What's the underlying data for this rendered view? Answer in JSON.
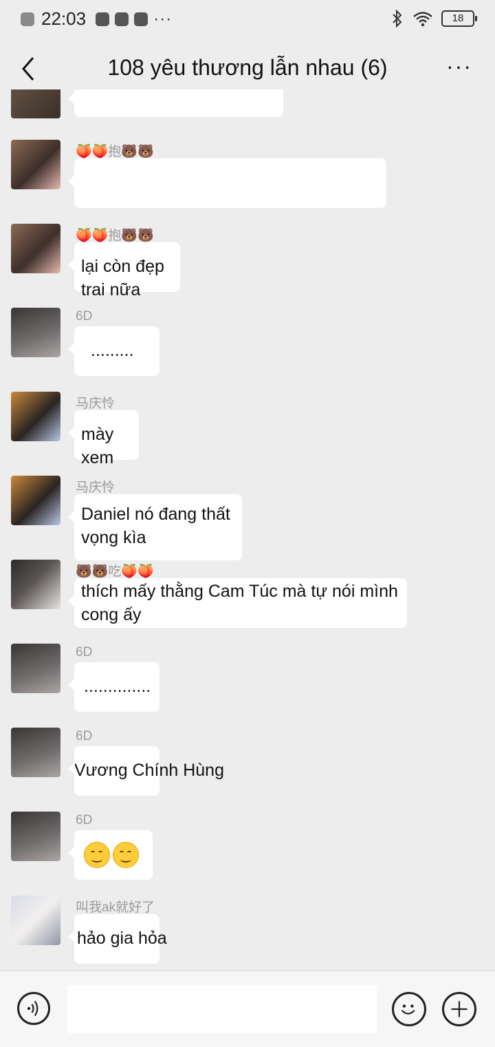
{
  "status_bar": {
    "time": "22:03",
    "battery": "18"
  },
  "header": {
    "title": "108 yêu thương lẫn nhau (6)"
  },
  "messages": [
    {
      "sender": "",
      "text": ""
    },
    {
      "sender": "🍑🍑抱🐻🐻",
      "text": ""
    },
    {
      "sender": "🍑🍑抱🐻🐻",
      "text": "lại còn đẹp trai nữa"
    },
    {
      "sender": "6D",
      "text": "........."
    },
    {
      "sender": "马庆怜",
      "text": "mày xem"
    },
    {
      "sender": "马庆怜",
      "text": "Daniel nó đang thất vọng kìa"
    },
    {
      "sender": "🐻🐻吃🍑🍑",
      "text": "thích mấy thằng Cam Túc mà tự nói mình cong ấy"
    },
    {
      "sender": "6D",
      "text": ".............."
    },
    {
      "sender": "6D",
      "text": "Vương Chính Hùng"
    },
    {
      "sender": "6D",
      "emoji": "smiling-face-emoji x2"
    },
    {
      "sender": "叫我ak就好了",
      "text": "hảo gia hỏa"
    }
  ],
  "colors": {
    "background": "#ededed",
    "bubble": "#ffffff",
    "sender": "#9a9a9a",
    "input_bar": "#f6f6f6"
  }
}
